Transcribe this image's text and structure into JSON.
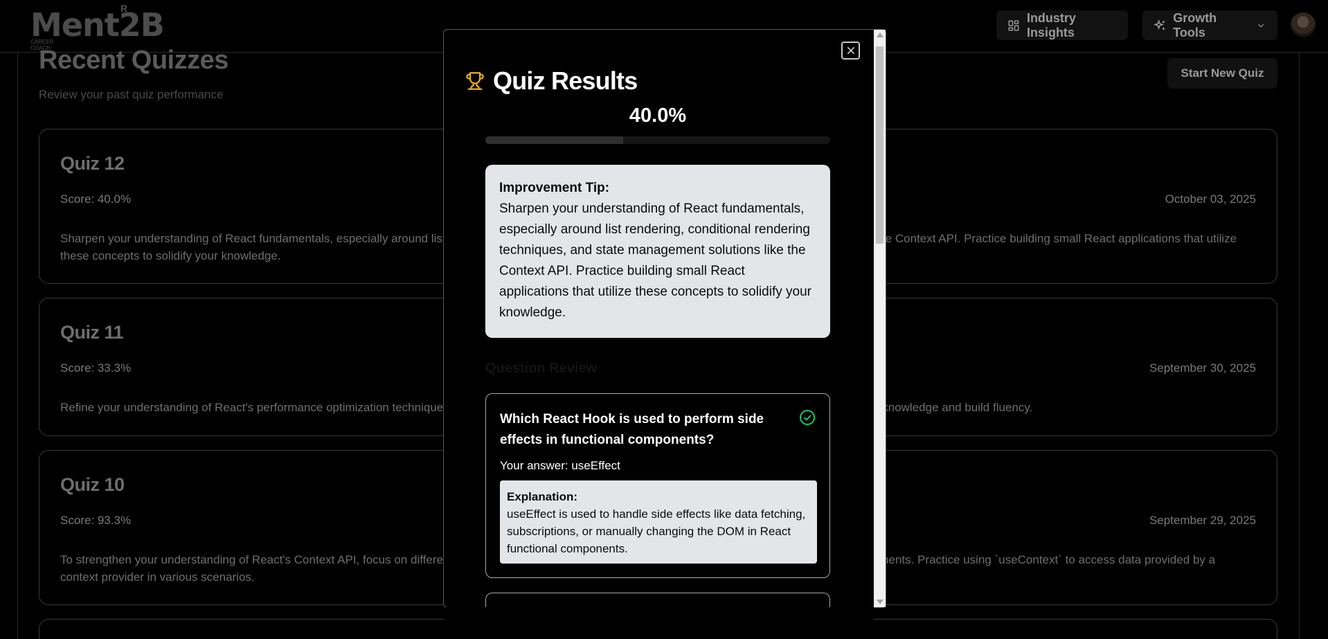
{
  "app": {
    "logo_text": "Ment2B",
    "logo_reg": "R",
    "logo_tagline": "CAREER COACH"
  },
  "nav": {
    "insights_label": "Industry Insights",
    "growth_label": "Growth Tools",
    "insights_icon": "layout-dashboard-icon",
    "growth_icon": "sparkles-icon",
    "growth_chevron": "chevron-down-icon",
    "avatar": "user-avatar"
  },
  "page": {
    "title": "Recent Quizzes",
    "subtitle": "Review your past quiz performance",
    "start_button": "Start New Quiz"
  },
  "quizzes": [
    {
      "title": "Quiz 12",
      "score": "Score: 40.0%",
      "date": "October 03, 2025",
      "tip": "Sharpen your understanding of React fundamentals, especially around list rendering, conditional rendering techniques, and state management solutions like the Context API. Practice building small React applications that utilize these concepts to solidify your knowledge."
    },
    {
      "title": "Quiz 11",
      "score": "Score: 33.3%",
      "date": "September 30, 2025",
      "tip": "Refine your understanding of React's performance optimization techniques, memoization, and how to apply JavaScript expressions within JSX to solidify your knowledge and build fluency."
    },
    {
      "title": "Quiz 10",
      "score": "Score: 93.3%",
      "date": "September 29, 2025",
      "tip": "To strengthen your understanding of React's Context API, focus on differentiating between providers and consumers and how they pass data to nested components. Practice using `useContext` to access data provided by a context provider in various scenarios."
    }
  ],
  "modal": {
    "title": "Quiz Results",
    "score_text": "40.0%",
    "score_fraction": 0.4,
    "tip_label": "Improvement Tip:",
    "tip_text": "Sharpen your understanding of React fundamentals, especially around list rendering, conditional rendering techniques, and state management solutions like the Context API. Practice building small React applications that utilize these concepts to solidify your knowledge.",
    "review_heading": "Question Review",
    "question": {
      "text": "Which React Hook is used to perform side effects in functional components?",
      "answer": "Your answer: useEffect",
      "correct": true,
      "explanation_label": "Explanation:",
      "explanation": "useEffect is used to handle side effects like data fetching, subscriptions, or manually changing the DOM in React functional components."
    }
  },
  "colors": {
    "background": "#000000",
    "card_border": "#3a3a3a",
    "tip_bg": "#e4e5e9",
    "trophy": "#e2a823",
    "check": "#22c55e"
  }
}
